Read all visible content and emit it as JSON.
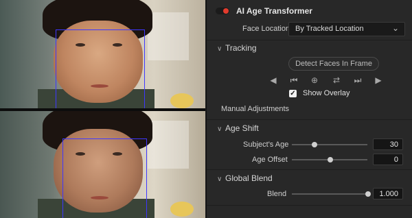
{
  "panel": {
    "title": "AI Age Transformer",
    "enabled": true,
    "face_location": {
      "label": "Face Location",
      "value": "By Tracked Location"
    },
    "tracking": {
      "section_label": "Tracking",
      "detect_button": "Detect Faces In Frame",
      "show_overlay": {
        "label": "Show Overlay",
        "checked": true
      }
    },
    "manual_adjustments_label": "Manual Adjustments",
    "age_shift": {
      "section_label": "Age Shift",
      "subjects_age": {
        "label": "Subject's Age",
        "value": "30",
        "level": 0.2
      },
      "age_offset": {
        "label": "Age Offset",
        "value": "0",
        "level": 0.5
      }
    },
    "global_blend": {
      "section_label": "Global Blend",
      "blend": {
        "label": "Blend",
        "value": "1.000",
        "level": 1.0
      }
    }
  },
  "colors": {
    "accent_red": "#e23b2d",
    "overlay_box": "#3e37ff",
    "panel_bg": "#282828"
  }
}
